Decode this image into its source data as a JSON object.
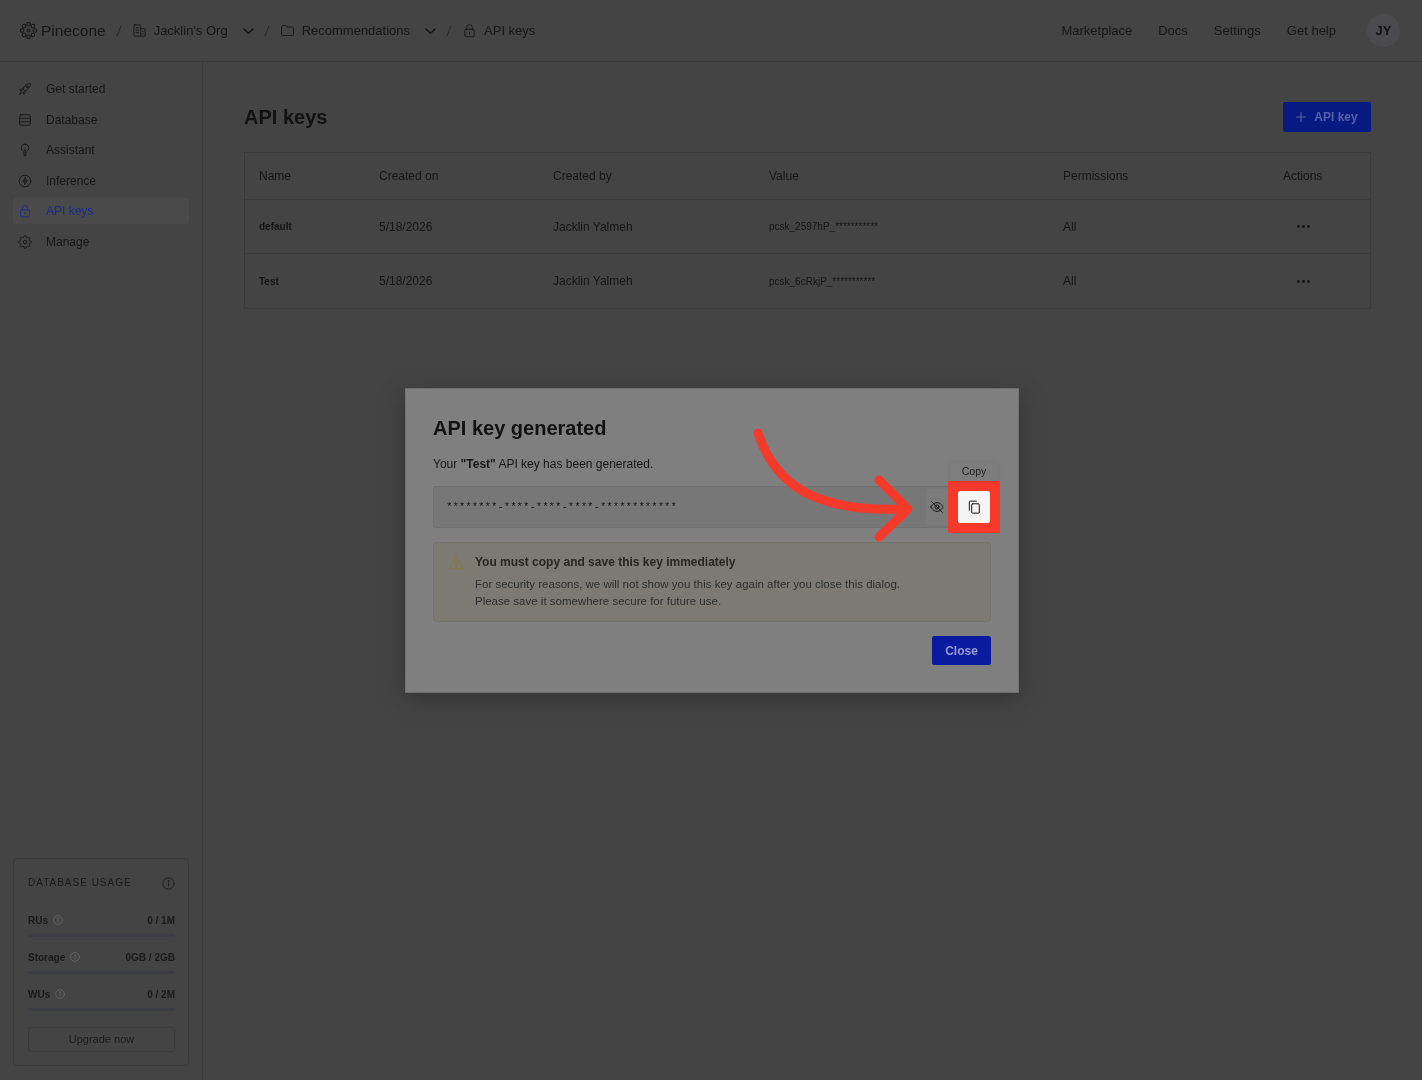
{
  "topbar": {
    "logo": "Pinecone",
    "breadcrumbs": [
      {
        "kind": "org",
        "label": "Jacklin's Org",
        "dropdown": true
      },
      {
        "kind": "project",
        "label": "Recommendations",
        "dropdown": true
      },
      {
        "kind": "page",
        "label": "API keys",
        "dropdown": false
      }
    ],
    "links": [
      "Marketplace",
      "Docs",
      "Settings",
      "Get help"
    ],
    "avatar": "JY"
  },
  "sidebar": {
    "items": [
      {
        "kind": "rocket",
        "label": "Get started",
        "selected": false
      },
      {
        "kind": "database",
        "label": "Database",
        "selected": false
      },
      {
        "kind": "bulb",
        "label": "Assistant",
        "selected": false
      },
      {
        "kind": "bolt",
        "label": "Inference",
        "selected": false
      },
      {
        "kind": "lock",
        "label": "API keys",
        "selected": true
      },
      {
        "kind": "gear",
        "label": "Manage",
        "selected": false
      }
    ],
    "usage": {
      "title": "DATABASE USAGE",
      "meters": [
        {
          "label": "RUs",
          "reading": "0 / 1M",
          "level": 0
        },
        {
          "label": "Storage",
          "reading": "0GB / 2GB",
          "level": 0
        },
        {
          "label": "WUs",
          "reading": "0 / 2M",
          "level": 0
        }
      ],
      "button": "Upgrade now"
    }
  },
  "main": {
    "title": "API keys",
    "add_button": "API key",
    "table": {
      "columns": [
        "Name",
        "Created on",
        "Created by",
        "Value",
        "Permissions",
        "Actions"
      ],
      "rows": [
        {
          "name": "default",
          "created_on": "5/18/2026",
          "created_by": "Jacklin Yalmeh",
          "value": "pcsk_2597hP_***********",
          "permissions": "All"
        },
        {
          "name": "Test",
          "created_on": "5/18/2026",
          "created_by": "Jacklin Yalmeh",
          "value": "pcsk_6cRkjP_***********",
          "permissions": "All"
        }
      ]
    }
  },
  "dialog": {
    "title": "API key generated",
    "message": "Your **\"Test\"** API key has been generated.",
    "key_field": {
      "value": "********-****-****-****-************",
      "masked": true,
      "copy_button": {
        "tooltip": "Copy",
        "highlighted": true
      }
    },
    "warning": {
      "title": "You must copy and save this key immediately",
      "text": "For security reasons, we will not show you this key again after you close this dialog. Please save it somewhere secure for future use."
    },
    "close_button": "Close"
  }
}
